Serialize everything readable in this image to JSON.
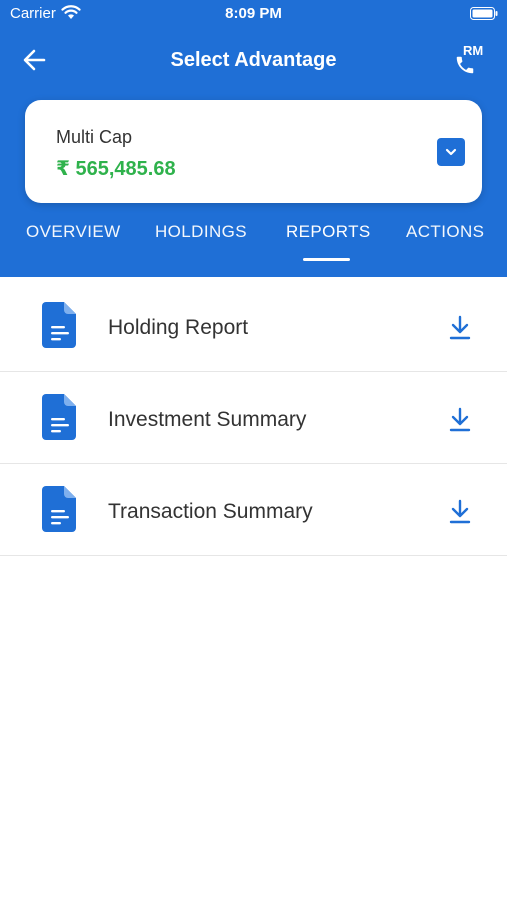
{
  "status_bar": {
    "carrier": "Carrier",
    "time": "8:09 PM",
    "icons": [
      "wifi-icon",
      "battery-icon"
    ]
  },
  "nav": {
    "title": "Select Advantage",
    "back_icon": "arrow-left-icon",
    "rm_label": "RM",
    "rm_icon": "phone-icon"
  },
  "portfolio": {
    "name": "Multi Cap",
    "value": "₹ 565,485.68",
    "dropdown_icon": "chevron-down-icon"
  },
  "tabs": [
    {
      "label": "OVERVIEW",
      "active": false
    },
    {
      "label": "HOLDINGS",
      "active": false
    },
    {
      "label": "REPORTS",
      "active": true
    },
    {
      "label": "ACTIONS",
      "active": false
    }
  ],
  "reports": [
    {
      "label": "Holding Report",
      "icon": "document-icon",
      "action_icon": "download-icon"
    },
    {
      "label": "Investment Summary",
      "icon": "document-icon",
      "action_icon": "download-icon"
    },
    {
      "label": "Transaction Summary",
      "icon": "document-icon",
      "action_icon": "download-icon"
    }
  ],
  "colors": {
    "primary": "#1f6fd6",
    "value_green": "#2fb24c",
    "text_dark": "#333333",
    "divider": "#e6e6e6"
  }
}
